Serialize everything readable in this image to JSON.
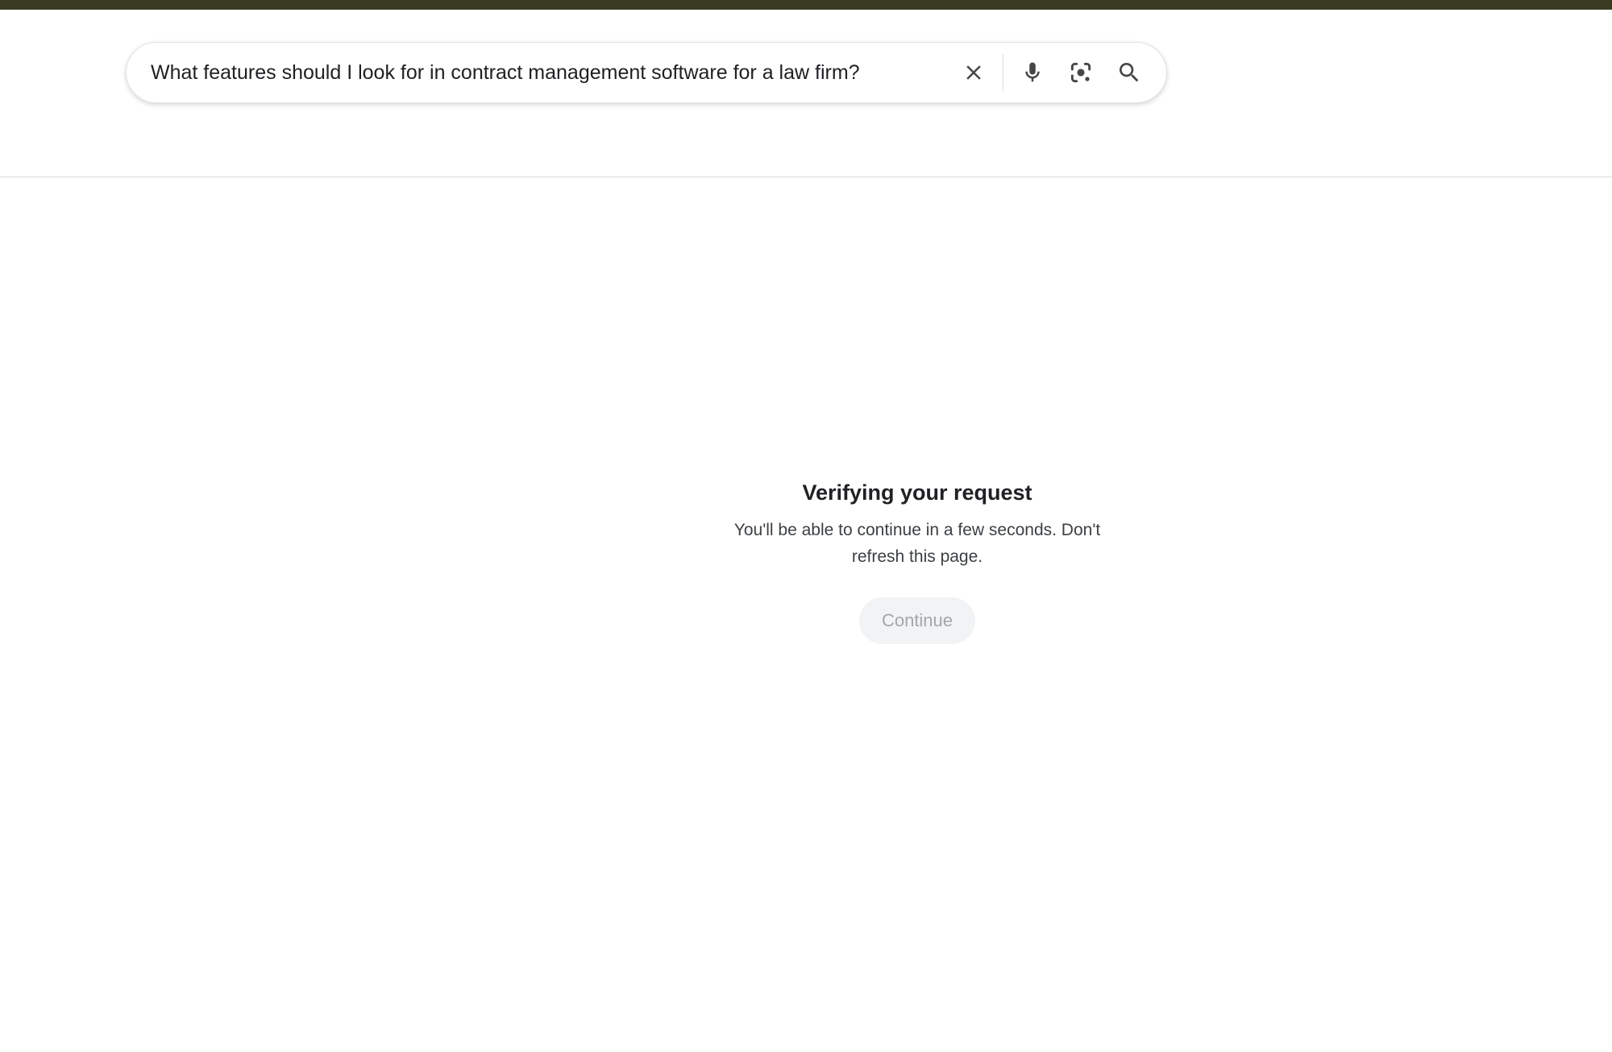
{
  "search": {
    "query": "What features should I look for in contract management software for a law firm?",
    "clear_icon": "close-icon",
    "voice_icon": "microphone-icon",
    "lens_icon": "camera-lens-icon",
    "search_icon": "search-icon"
  },
  "verification": {
    "title": "Verifying your request",
    "message": "You'll be able to continue in a few seconds. Don't refresh this page.",
    "continue_label": "Continue",
    "continue_enabled": false
  },
  "colors": {
    "top_strip": "#3b3a23",
    "icon": "#444746",
    "disabled_button_bg": "#f1f3f4",
    "disabled_button_text": "#a3a7ab"
  }
}
